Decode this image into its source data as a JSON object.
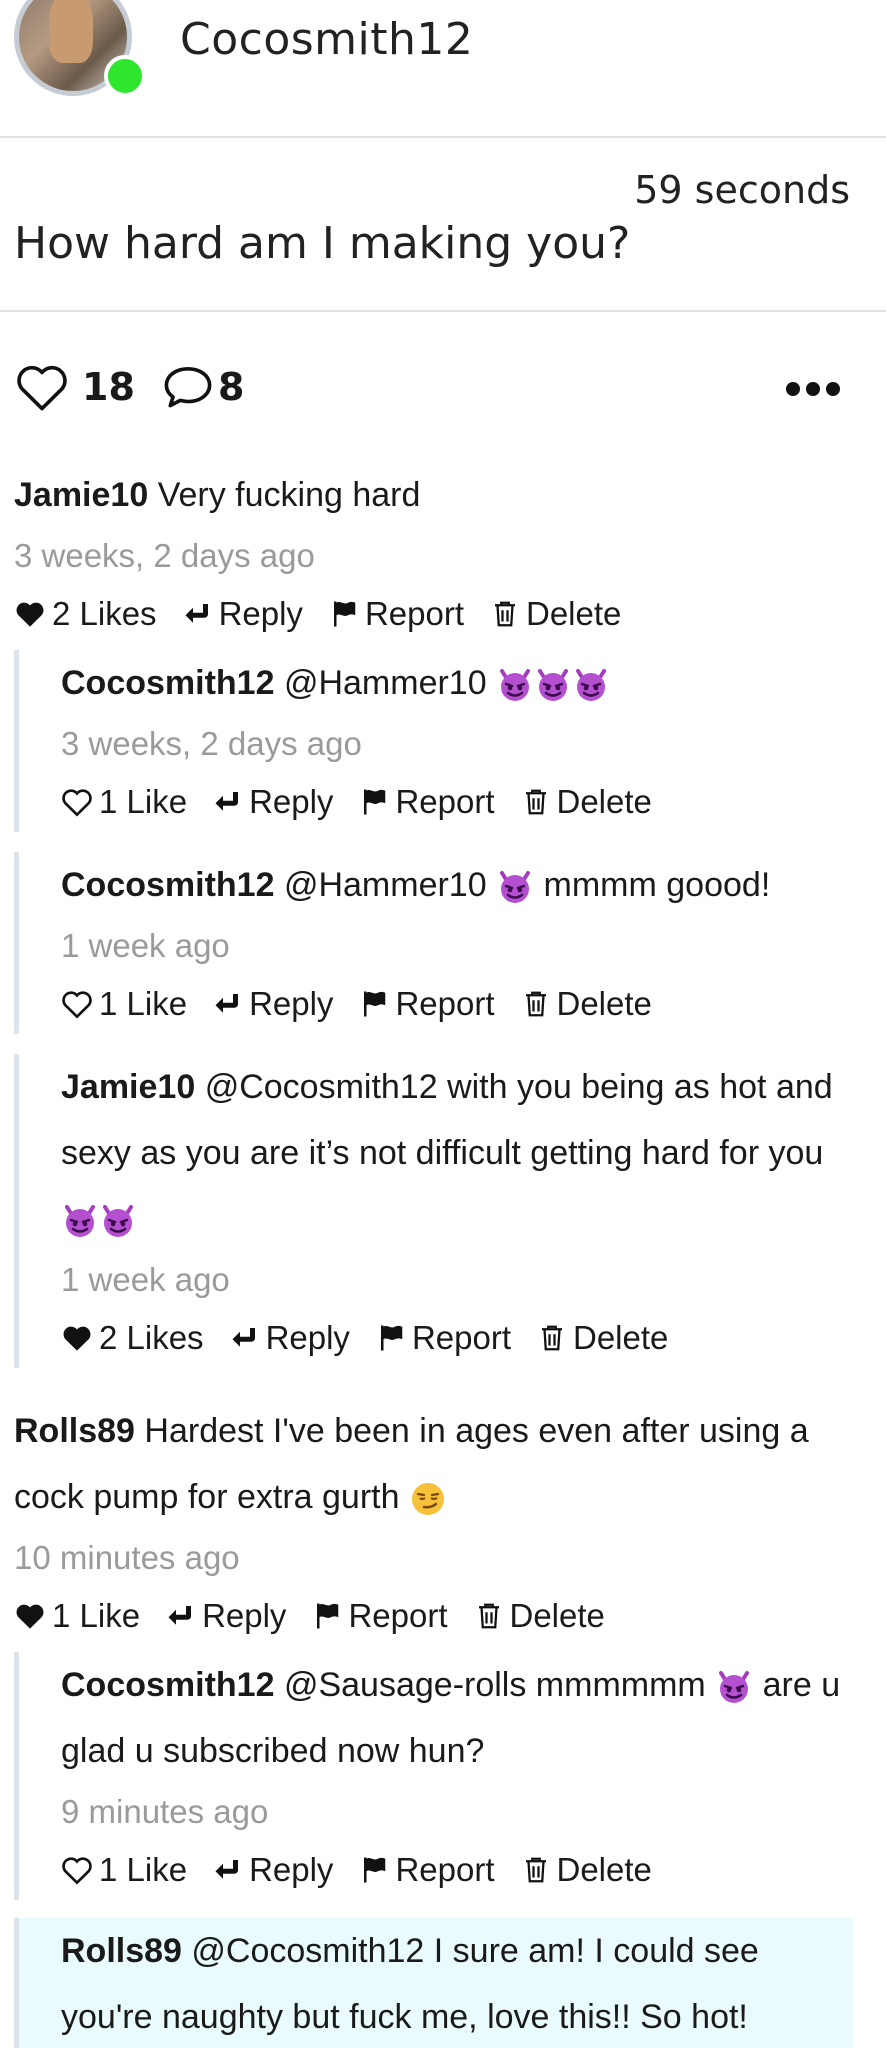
{
  "header": {
    "username": "Cocosmith12"
  },
  "post": {
    "time": "59 seconds",
    "text": "How hard am I making you?"
  },
  "actions": {
    "likes": "18",
    "comments": "8"
  },
  "comment_actions": {
    "reply": "Reply",
    "report": "Report",
    "delete": "Delete"
  },
  "comments": [
    {
      "user": "Jamie10",
      "text": "Very fucking hard",
      "time": "3 weeks, 2 days ago",
      "likes": "2 Likes",
      "liked": true
    },
    {
      "user": "Cocosmith12",
      "text": "@Hammer10",
      "emojis_after": [
        "devil-emoji",
        "devil-emoji",
        "devil-emoji"
      ],
      "time": "3 weeks, 2 days ago",
      "likes": "1 Like",
      "liked": false
    },
    {
      "user": "Cocosmith12",
      "text": "@Hammer10",
      "text2": "mmmm goood!",
      "time": "1 week ago",
      "likes": "1 Like",
      "liked": false
    },
    {
      "user": "Jamie10",
      "text": "@Cocosmith12 with you being as hot and sexy as you are it’s not difficult getting hard for you",
      "time": "1 week ago",
      "likes": "2 Likes",
      "liked": true
    },
    {
      "user": "Rolls89",
      "text": "Hardest I've been in ages even after using a cock pump for extra gurth",
      "time": "10 minutes ago",
      "likes": "1 Like",
      "liked": true
    },
    {
      "user": "Cocosmith12",
      "text": "@Sausage-rolls mmmmmm",
      "text2": "are u glad u subscribed now hun?",
      "time": "9 minutes ago",
      "likes": "1 Like",
      "liked": false
    },
    {
      "user": "Rolls89",
      "text": "@Cocosmith12 I sure am! I could see you're naughty but fuck me, love this!! So hot!"
    }
  ]
}
